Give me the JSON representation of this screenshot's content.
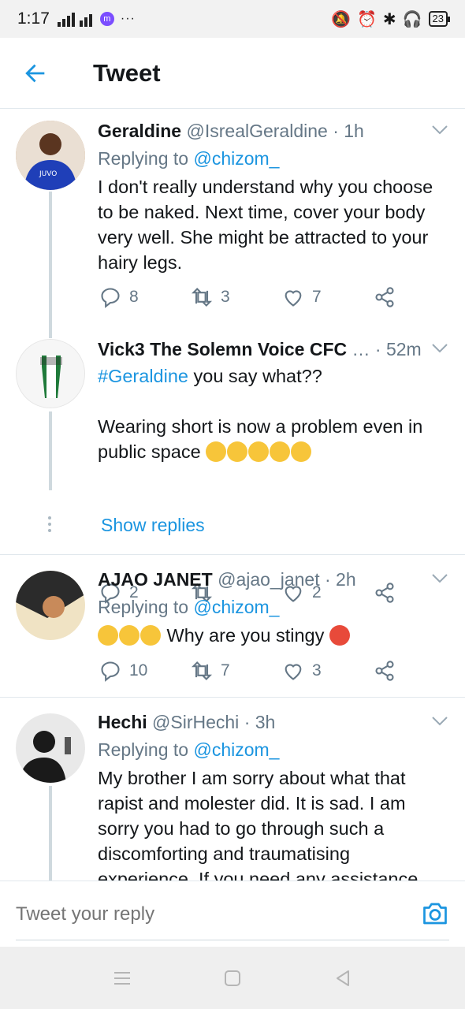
{
  "status_bar": {
    "time": "1:17",
    "network": "4G",
    "messenger_badge": "m",
    "dots": "···",
    "battery": "23"
  },
  "header": {
    "title": "Tweet"
  },
  "tweets": [
    {
      "name": "Geraldine",
      "handle": "@IsrealGeraldine",
      "ago": "· 1h",
      "reply_prefix": "Replying to",
      "reply_to": "@chizom_",
      "text": "I don't really understand why you choose to be naked. Next time, cover your body very well. She might be attracted to your hairy legs.",
      "replies": "8",
      "retweets": "3",
      "likes": "7"
    },
    {
      "name": "Vick3 The Solemn Voice CFC",
      "handle": "…",
      "ago": "· 52m",
      "hashtag": "#Geraldine",
      "text_after_hashtag": " you say what??",
      "text_second": "Wearing short is now a problem even in public space",
      "replies": "2",
      "retweets": "",
      "likes": "2",
      "show_replies": "Show replies"
    },
    {
      "name": "AJAO JANET",
      "handle": "@ajao_janet",
      "ago": "· 2h",
      "reply_prefix": "Replying to",
      "reply_to": "@chizom_",
      "text": "Why are you stingy",
      "replies": "10",
      "retweets": "7",
      "likes": "3"
    },
    {
      "name": "Hechi",
      "handle": "@SirHechi",
      "ago": "· 3h",
      "reply_prefix": "Replying to",
      "reply_to": "@chizom_",
      "text": "My brother I am sorry about what that rapist and molester did. It is sad. I am sorry you had to go through such a discomforting and traumatising experience. If you need any assistance"
    }
  ],
  "reply_bar": {
    "placeholder": "Tweet your reply"
  },
  "colors": {
    "accent": "#1b95e0",
    "muted": "#657786",
    "divider": "#e1e8ed"
  }
}
